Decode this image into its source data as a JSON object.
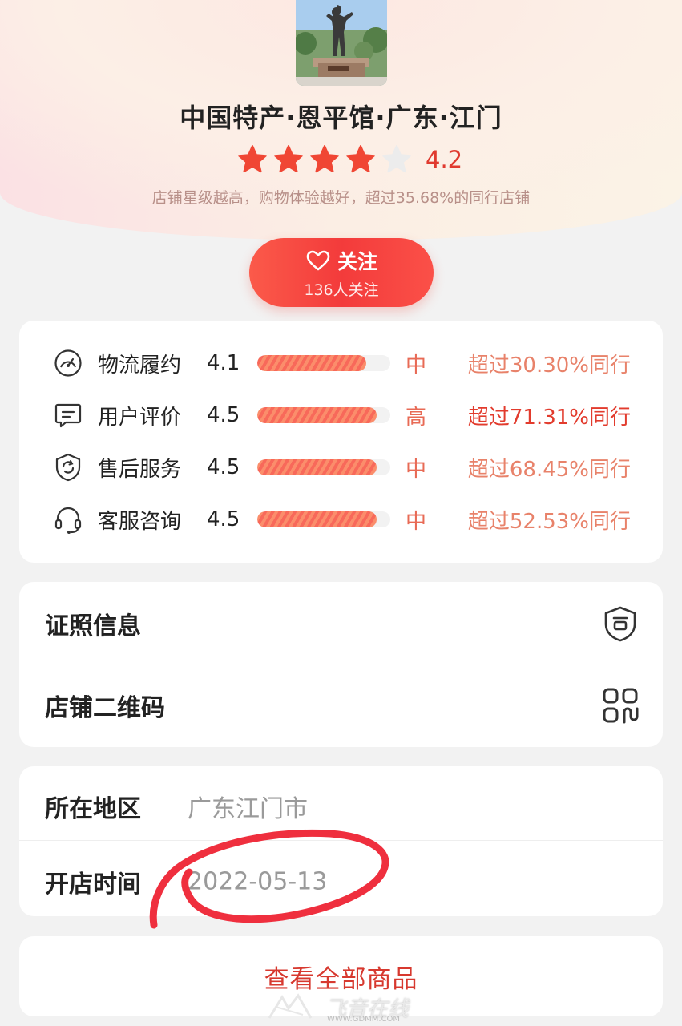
{
  "shop": {
    "name": "中国特产·恩平馆·广东·江门",
    "rating": "4.2",
    "stars_filled": 4,
    "stars_total": 5,
    "rating_desc": "店铺星级越高，购物体验越好，超过35.68%的同行店铺"
  },
  "follow": {
    "label": "关注",
    "count_text": "136人关注"
  },
  "metrics": [
    {
      "label": "物流履约",
      "score": "4.1",
      "level": "中",
      "compare": "超过30.30%同行",
      "fill": 0.82,
      "icon": "speedometer-icon"
    },
    {
      "label": "用户评价",
      "score": "4.5",
      "level": "高",
      "compare": "超过71.31%同行",
      "fill": 0.9,
      "icon": "comment-icon"
    },
    {
      "label": "售后服务",
      "score": "4.5",
      "level": "中",
      "compare": "超过68.45%同行",
      "fill": 0.9,
      "icon": "refresh-shield-icon"
    },
    {
      "label": "客服咨询",
      "score": "4.5",
      "level": "中",
      "compare": "超过52.53%同行",
      "fill": 0.9,
      "icon": "headset-icon"
    }
  ],
  "links": [
    {
      "label": "证照信息",
      "icon": "license-shield-icon"
    },
    {
      "label": "店铺二维码",
      "icon": "qr-code-icon"
    }
  ],
  "info": {
    "region_label": "所在地区",
    "region_value": "广东江门市",
    "open_label": "开店时间",
    "open_value": "2022-05-13"
  },
  "all_products_label": "查看全部商品",
  "watermark": {
    "text": "飞音在线",
    "url": "WWW.GDMM.COM"
  },
  "colors": {
    "accent": "#f33b3b",
    "star": "#f04634",
    "rating": "#e03a2f",
    "level": "#e86a55",
    "link": "#d7392f",
    "annotation": "#ef2f3e"
  }
}
